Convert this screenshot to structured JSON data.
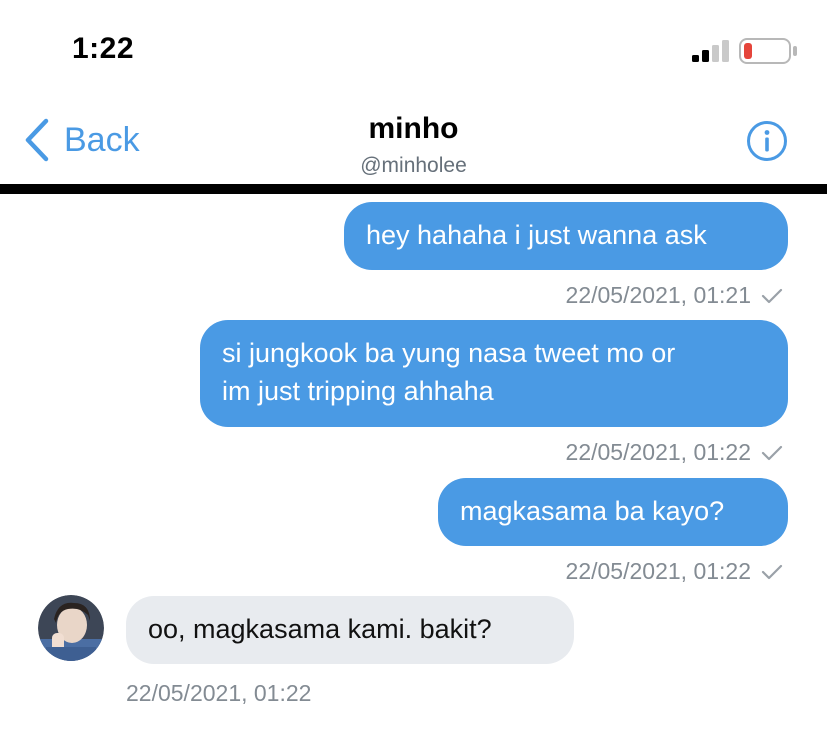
{
  "status_bar": {
    "time": "1:22",
    "signal_icon": "cellular-signal-icon",
    "battery_icon": "battery-low-icon",
    "battery_color": "#e5453b"
  },
  "header": {
    "back_label": "Back",
    "title": "minho",
    "handle": "@minholee",
    "back_icon": "chevron-left-icon",
    "info_icon": "info-icon",
    "accent_color": "#4a9ae4"
  },
  "messages": [
    {
      "direction": "sent",
      "lines": [
        "hey hahaha i just wanna ask"
      ],
      "timestamp": "22/05/2021, 01:21",
      "status_icon": "checkmark-icon"
    },
    {
      "direction": "sent",
      "lines": [
        "si jungkook ba yung nasa tweet mo or",
        "im just tripping ahhaha"
      ],
      "timestamp": "22/05/2021, 01:22",
      "status_icon": "checkmark-icon"
    },
    {
      "direction": "sent",
      "lines": [
        "magkasama ba kayo?"
      ],
      "timestamp": "22/05/2021, 01:22",
      "status_icon": "checkmark-icon"
    },
    {
      "direction": "received",
      "lines": [
        "oo, magkasama kami. bakit?"
      ],
      "timestamp": "22/05/2021, 01:22",
      "avatar_icon": "avatar"
    }
  ]
}
